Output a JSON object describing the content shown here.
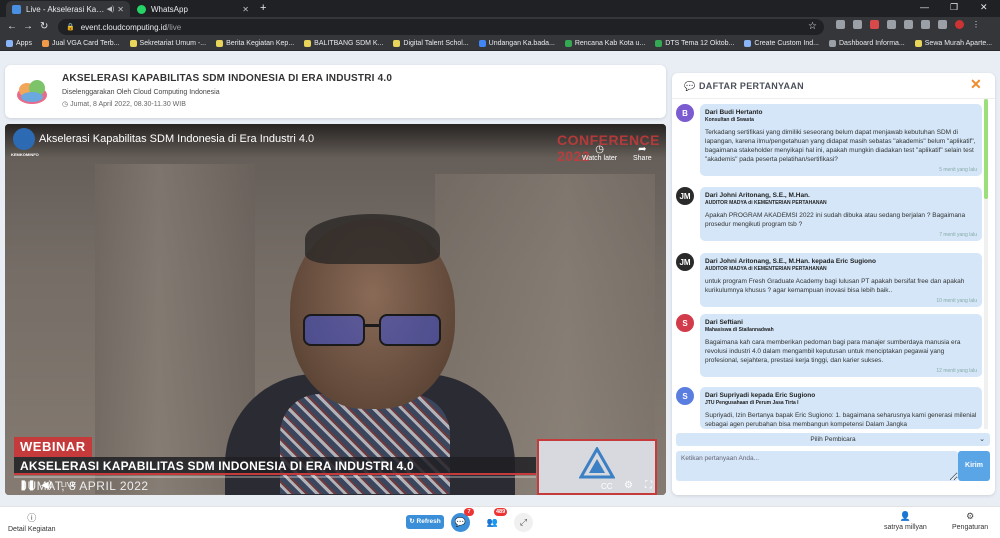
{
  "browser": {
    "tabs": [
      {
        "title": "Live - Akselerasi Kapabilitas",
        "active": true
      },
      {
        "title": "WhatsApp",
        "active": false
      }
    ],
    "url_host": "event.cloudcomputing.id",
    "url_path": "/live",
    "bookmarks": [
      "Apps",
      "Jual VGA Card Terb...",
      "Sekretariat Umum -...",
      "Berita Kegiatan Kep...",
      "BALITBANG SDM K...",
      "Digital Talent Schol...",
      "Undangan Ka.bada...",
      "Rencana Kab Kota u...",
      "DTS Tema 12 Oktob...",
      "Create Custom Ind...",
      "Dashboard Informa...",
      "Sewa Murah Aparte..."
    ]
  },
  "event": {
    "title": "AKSELERASI KAPABILITAS SDM INDONESIA DI ERA INDUSTRI 4.0",
    "organizer": "Diselenggarakan Oleh Cloud Computing Indonesia",
    "date": "Jumat, 8 April 2022, 08.30-11.30 WIB"
  },
  "video": {
    "title": "Akselerasi Kapabilitas SDM Indonesia di Era Industri 4.0",
    "channel_label": "KEMKOMINFO",
    "watch_later": "Watch later",
    "share": "Share",
    "conference_label": "CONFERENCE 2022",
    "webinar_tag": "WEBINAR",
    "lower_title": "AKSELERASI KAPABILITAS SDM INDONESIA DI ERA INDUSTRI 4.0",
    "lower_date": "JUMAT, 8 APRIL 2022",
    "live_label": "LIVE"
  },
  "questions_panel": {
    "title": "DAFTAR PERTANYAAN",
    "items": [
      {
        "initial": "B",
        "color": "#7a5bd0",
        "name": "Dari Budi Hertanto",
        "role": "Konsultan di Swasta",
        "text": "Terkadang sertifikasi yang dimiliki seseorang belum dapat menjawab kebutuhan SDM di lapangan, karena ilmu/pengetahuan yang didapat masih sebatas \"akademis\" belum \"aplikatif\", bagaimana stakeholder menyikapi hal ini, apakah mungkin diadakan test \"aplikatif\" selain test \"akademis\" pada peserta pelatihan/sertifikasi?",
        "time": "5 menit yang lalu"
      },
      {
        "initial": "JM",
        "color": "#2a2a2a",
        "name": "Dari Johni Aritonang, S.E., M.Han.",
        "role": "AUDITOR MADYA di KEMENTERIAN PERTAHANAN",
        "text": "Apakah PROGRAM AKADEMSI 2022 ini sudah dibuka atau sedang berjalan ? Bagaimana prosedur mengikuti program tsb ?",
        "time": "7 menit yang lalu"
      },
      {
        "initial": "JM",
        "color": "#2a2a2a",
        "name": "Dari Johni Aritonang, S.E., M.Han. kepada Eric Sugiono",
        "role": "AUDITOR MADYA di KEMENTERIAN PERTAHANAN",
        "text": "untuk program Fresh Graduate Academy bagi lulusan PT apakah bersifat free dan apakah kurikulumnya khusus ? agar kemampuan inovasi bisa lebih baik..",
        "time": "10 menit yang lalu"
      },
      {
        "initial": "S",
        "color": "#d23b4a",
        "name": "Dari Seftiani",
        "role": "Mahasiswa di Stailannadwah",
        "text": "Bagaimana kah cara memberikan pedoman bagi para manajer sumberdaya manusia era revolusi industri 4.0 dalam mengambil keputusan untuk menciptakan pegawai yang profesional, sejahtera, prestasi kerja tinggi, dan karier sukses.",
        "time": "12 menit yang lalu"
      },
      {
        "initial": "S",
        "color": "#5a7de0",
        "name": "Dari Supriyadi kepada Eric Sugiono",
        "role": "JTU Pengusahaan di Perum Jasa Tirta I",
        "text": "Supriyadi, Izin Bertanya bapak Eric Sugiono: 1. bagaimana seharusnya kami generasi milenial sebagai agen perubahan bisa membangun kompetensi Dalam Jangka",
        "time": ""
      }
    ],
    "speaker_select": "Pilih Pembicara",
    "input_placeholder": "Ketikan pertanyaan Anda...",
    "send_label": "Kirim"
  },
  "bottom_bar": {
    "detail_label": "Detail Kegiatan",
    "refresh_label": "Refresh",
    "chat_badge": "7",
    "participants_badge": "489",
    "user_name": "satrya millyan",
    "settings_label": "Pengaturan"
  }
}
